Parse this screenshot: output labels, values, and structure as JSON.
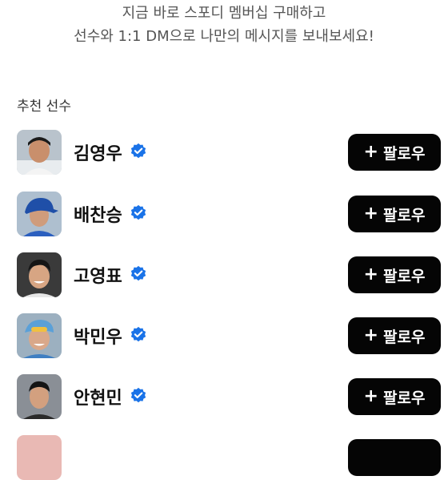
{
  "promo": {
    "line1": "지금 바로 스포디 멤버십 구매하고",
    "line2": "선수와 1:1 DM으로 나만의 메시지를 보내보세요!"
  },
  "section": {
    "title": "추천 선수"
  },
  "players": [
    {
      "name": "김영우",
      "follow_label": "팔로우",
      "plus": "+"
    },
    {
      "name": "배찬승",
      "follow_label": "팔로우",
      "plus": "+"
    },
    {
      "name": "고영표",
      "follow_label": "팔로우",
      "plus": "+"
    },
    {
      "name": "박민우",
      "follow_label": "팔로우",
      "plus": "+"
    },
    {
      "name": "안현민",
      "follow_label": "팔로우",
      "plus": "+"
    }
  ],
  "icons": {
    "verified": "verified-badge-icon",
    "follow": "plus-icon"
  },
  "colors": {
    "verified": "#1a73e8",
    "button_bg": "#050505",
    "button_text": "#ffffff"
  }
}
